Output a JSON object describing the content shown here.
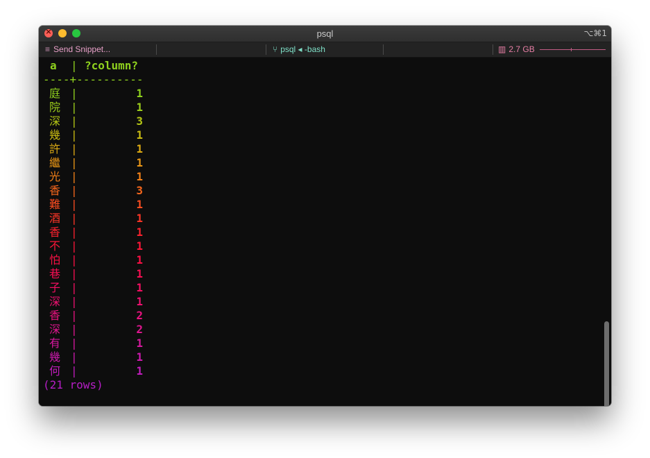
{
  "window": {
    "title": "psql",
    "shortcut": "⌥⌘1"
  },
  "statusbar": {
    "snippet_label": "Send Snippet...",
    "session_label": "psql ◂ -bash",
    "memory_label": "2.7 GB"
  },
  "icons": {
    "close": "close-icon",
    "minimize": "minimize-icon",
    "maximize": "maximize-icon",
    "snippet": "menu-icon",
    "session": "branch-icon",
    "memory": "memory-icon"
  },
  "query": {
    "columns": [
      "a",
      "?column?"
    ],
    "separator": "----+----------",
    "rows": [
      {
        "a": "庭",
        "count": "1",
        "color": "#8fd11e"
      },
      {
        "a": "院",
        "count": "1",
        "color": "#9bcc1b"
      },
      {
        "a": "深",
        "count": "3",
        "color": "#b4c615"
      },
      {
        "a": "幾",
        "count": "1",
        "color": "#c9bb12"
      },
      {
        "a": "許",
        "count": "1",
        "color": "#dba913"
      },
      {
        "a": "繼",
        "count": "1",
        "color": "#e89616"
      },
      {
        "a": "光",
        "count": "1",
        "color": "#f07f18"
      },
      {
        "a": "香",
        "count": "3",
        "color": "#f5661c"
      },
      {
        "a": "難",
        "count": "1",
        "color": "#f84c20"
      },
      {
        "a": "酒",
        "count": "1",
        "color": "#fa3526"
      },
      {
        "a": "香",
        "count": "1",
        "color": "#fb222e"
      },
      {
        "a": "不",
        "count": "1",
        "color": "#fb1638"
      },
      {
        "a": "怕",
        "count": "1",
        "color": "#fa1044"
      },
      {
        "a": "巷",
        "count": "1",
        "color": "#f60e52"
      },
      {
        "a": "子",
        "count": "1",
        "color": "#f20f61"
      },
      {
        "a": "深",
        "count": "1",
        "color": "#ec1170"
      },
      {
        "a": "香",
        "count": "2",
        "color": "#e6137f"
      },
      {
        "a": "深",
        "count": "2",
        "color": "#de168f"
      },
      {
        "a": "有",
        "count": "1",
        "color": "#d6189e"
      },
      {
        "a": "幾",
        "count": "1",
        "color": "#cc1aad"
      },
      {
        "a": "何",
        "count": "1",
        "color": "#c11cbc"
      }
    ],
    "footer": "(21 rows)"
  },
  "colors": {
    "header": "#8fd11e",
    "separator": "#8fd11e",
    "footer": "#b61ec6",
    "terminal_bg": "#0d0d0d",
    "snippet": "#e8a0c8",
    "session": "#7fe0c8",
    "memory": "#e87fa6"
  }
}
